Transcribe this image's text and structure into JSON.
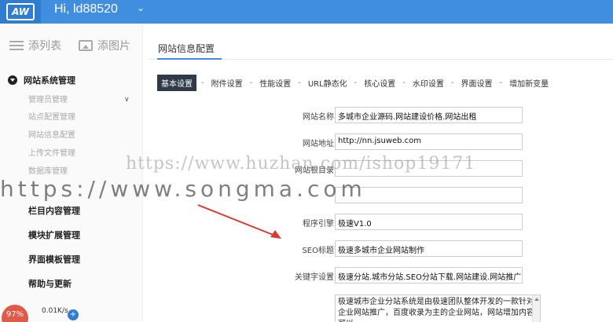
{
  "header": {
    "logo_text": "AW",
    "greeting": "Hi, ld88520"
  },
  "sidebar": {
    "quick_actions": [
      "添列表",
      "添图片"
    ],
    "section_title": "网站系统管理",
    "sub_items": [
      "管理员管理",
      "站点配置管理",
      "网站信息配置",
      "上传文件管理",
      "数据库管理"
    ],
    "groups": [
      "栏目内容管理",
      "模块扩展管理",
      "界面模板管理",
      "帮助与更新"
    ]
  },
  "status": {
    "percent": "97%",
    "speed": "0.01K/s"
  },
  "main": {
    "title": "网站信息配置",
    "tabs": [
      "基本设置",
      "附件设置",
      "性能设置",
      "URL静态化",
      "核心设置",
      "水印设置",
      "界面设置",
      "增加新变量"
    ],
    "form": [
      {
        "label": "网站名称：",
        "value": "多城市企业源码.网站建设价格.网站出租"
      },
      {
        "label": "网站地址：",
        "value": "http://nn.jsuweb.com"
      },
      {
        "label": "网站根目录：",
        "value": ""
      },
      {
        "label": "",
        "value": ""
      },
      {
        "label": "程序引擎：",
        "value": "极速V1.0"
      },
      {
        "label": "SEO标题：",
        "value": "极速多城市企业网站制作"
      },
      {
        "label": "关键字设置：",
        "value": "极速分站.城市分站.SEO分站下载.网站建设.网站推广"
      }
    ],
    "description": "极速城市企业分站系统是由极速团队整体开发的一款针对企业网站推广，百度收录为主的企业网站，网站增加内容可以"
  },
  "watermarks": {
    "line1": "https://www.huzhan.com/ishop19171",
    "line2": "https://www.songma.com"
  },
  "colors": {
    "header_blue": "#3f8ee0",
    "active_tab": "#2e3a4a",
    "arrow_red": "#d93a2b",
    "percent_badge": "#e05a47"
  }
}
